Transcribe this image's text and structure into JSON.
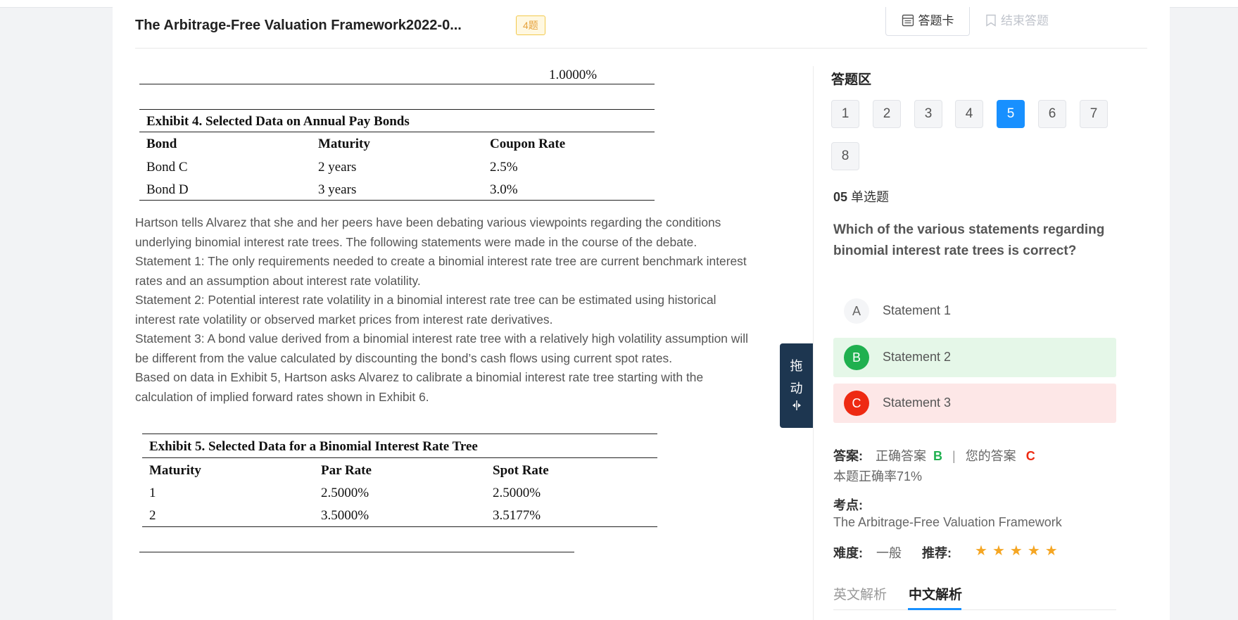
{
  "header": {
    "title": "The Arbitrage-Free Valuation Framework2022-0...",
    "count_badge": "4题",
    "answer_card_label": "答题卡",
    "end_label": "结束答题"
  },
  "content": {
    "prev_table_value": "1.0000%",
    "exhibit4": {
      "title": "Exhibit 4. Selected Data on Annual Pay Bonds",
      "headers": [
        "Bond",
        "Maturity",
        "Coupon Rate"
      ],
      "rows": [
        [
          "Bond C",
          "2 years",
          "2.5%"
        ],
        [
          "Bond D",
          "3 years",
          "3.0%"
        ]
      ]
    },
    "passage": [
      "Hartson tells Alvarez that she and her peers have been debating various viewpoints regarding the conditions underlying binomial interest rate trees. The following statements were made in the course of the debate.",
      "Statement 1: The only requirements needed to create a binomial interest rate tree are current benchmark interest rates and an assumption about interest rate volatility.",
      "Statement 2: Potential interest rate volatility in a binomial interest rate tree can be estimated using historical interest rate volatility or observed market prices from interest rate derivatives.",
      "Statement 3: A bond value derived from a binomial interest rate tree with a relatively high volatility assumption will be different from the value calculated by discounting the bond’s cash flows using current spot rates.",
      "Based on data in Exhibit 5, Hartson asks Alvarez to calibrate a binomial interest rate tree starting with the calculation of implied forward rates shown in Exhibit 6."
    ],
    "exhibit5": {
      "title": "Exhibit 5. Selected Data for a Binomial Interest Rate Tree",
      "headers": [
        "Maturity",
        "Par Rate",
        "Spot Rate"
      ],
      "rows": [
        [
          "1",
          "2.5000%",
          "2.5000%"
        ],
        [
          "2",
          "3.5000%",
          "3.5177%"
        ]
      ]
    }
  },
  "drag_handle": {
    "text1": "拖",
    "text2": "动",
    "icon": "drag-arrows-icon"
  },
  "answer_panel": {
    "section_title": "答题区",
    "question_numbers": [
      "1",
      "2",
      "3",
      "4",
      "5",
      "6",
      "7",
      "8"
    ],
    "active_question": "5",
    "question_index": "05",
    "question_type": "单选题",
    "question_text": "Which of the various statements regarding binomial interest rate trees is correct?",
    "options": [
      {
        "letter": "A",
        "text": "Statement 1"
      },
      {
        "letter": "B",
        "text": "Statement 2"
      },
      {
        "letter": "C",
        "text": "Statement 3"
      }
    ],
    "answer_label": "答案:",
    "correct_label": "正确答案",
    "correct_answer": "B",
    "separator": "|",
    "your_label": "您的答案",
    "your_answer": "C",
    "accuracy": "本题正确率71%",
    "knowledge_label": "考点:",
    "knowledge_value": "The Arbitrage-Free Valuation Framework",
    "difficulty_label": "难度:",
    "difficulty_value": "一般",
    "recommend_label": "推荐:",
    "recommend_stars": 5,
    "tabs": [
      "英文解析",
      "中文解析"
    ],
    "active_tab": "中文解析"
  },
  "colors": {
    "primary": "#1890ff",
    "correct": "#1fb04f",
    "wrong": "#ee2a12",
    "star": "#f5a623",
    "drag_handle": "#1d3650"
  }
}
